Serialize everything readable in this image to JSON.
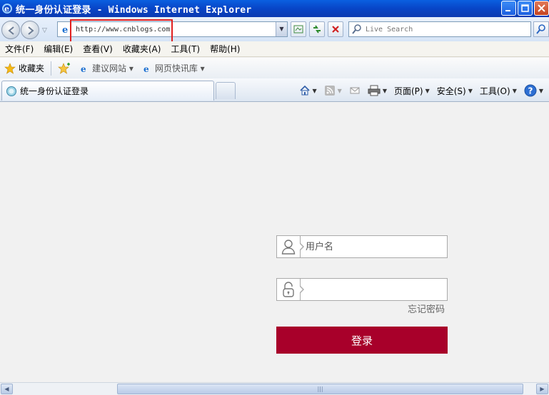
{
  "window": {
    "title": "统一身份认证登录 - Windows Internet Explorer"
  },
  "address_bar": {
    "url": "http://www.cnblogs.com"
  },
  "search": {
    "placeholder": "Live Search"
  },
  "menu": {
    "items": [
      "文件(F)",
      "编辑(E)",
      "查看(V)",
      "收藏夹(A)",
      "工具(T)",
      "帮助(H)"
    ]
  },
  "favorites": {
    "label": "收藏夹",
    "links": [
      "建议网站 ▾",
      "网页快讯库 ▾"
    ]
  },
  "tab": {
    "title": "统一身份认证登录"
  },
  "commandbar": {
    "page": "页面(P)",
    "safety": "安全(S)",
    "tools": "工具(O)"
  },
  "login": {
    "username_placeholder": "用户名",
    "password_placeholder": "",
    "forgot_password": "忘记密码",
    "submit": "登录"
  },
  "colors": {
    "login_button": "#a8002a",
    "titlebar": "#0845c7"
  }
}
